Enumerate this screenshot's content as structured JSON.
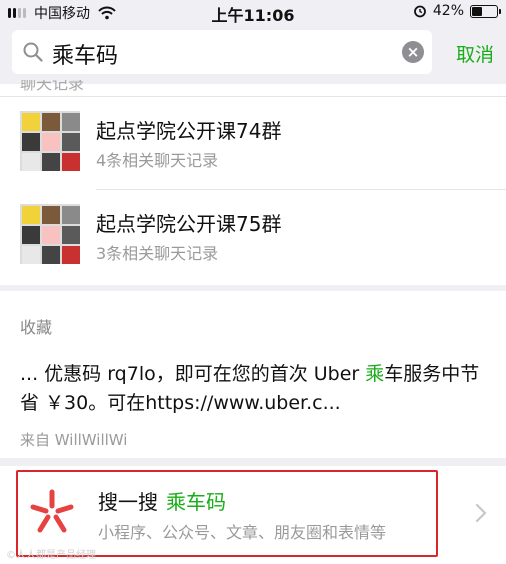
{
  "status_bar": {
    "carrier": "中国移动",
    "time": "上午11:06",
    "battery_percent": "42%",
    "battery_level": 0.42,
    "signal_bars_filled": 2,
    "signal_bars_total": 4,
    "icons": [
      "signal-icon",
      "wifi-icon",
      "alarm-icon",
      "battery-icon"
    ]
  },
  "search": {
    "value": "乘车码",
    "cancel_label": "取消",
    "clear_icon": "close-circle-icon"
  },
  "chat_section": {
    "header": "聊天记录",
    "items": [
      {
        "title": "起点学院公开课74群",
        "subtitle": "4条相关聊天记录"
      },
      {
        "title": "起点学院公开课75群",
        "subtitle": "3条相关聊天记录"
      }
    ]
  },
  "favorites_section": {
    "header": "收藏",
    "text_before": "... 优惠码 rq7lo，即可在您的首次 Uber ",
    "text_highlight": "乘",
    "text_after": "车服务中节省 ￥30。可在https://www.uber.c...",
    "source": "来自 WillWillWi"
  },
  "sousou": {
    "title": "搜一搜",
    "keyword": "乘车码",
    "subtitle": "小程序、公众号、文章、朋友圈和表情等",
    "icon": "sousou-logo-icon",
    "chevron": "chevron-right-icon"
  },
  "watermark": "©人人都是产品经理",
  "colors": {
    "accent_green": "#1aad19",
    "highlight_frame_red": "#d9262c",
    "logo_red": "#e64340",
    "background_gray": "#efeff4"
  }
}
